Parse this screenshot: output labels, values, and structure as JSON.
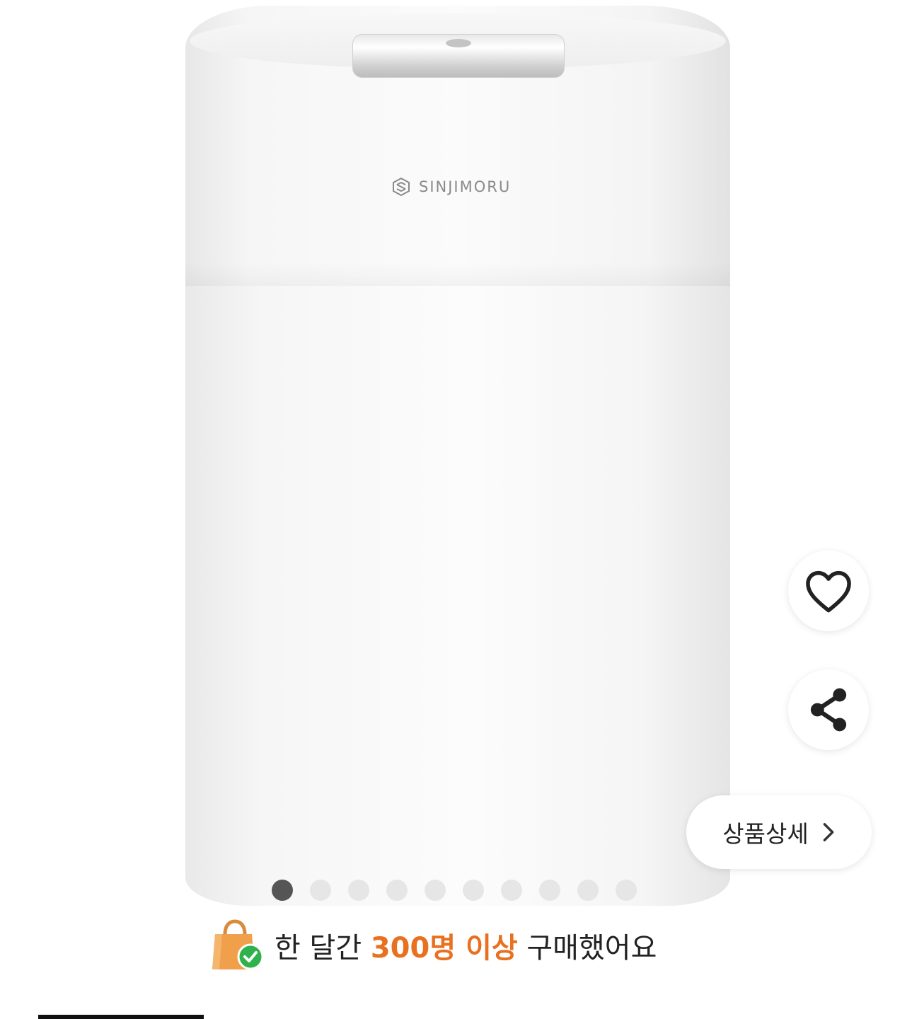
{
  "product": {
    "brand": "SINJIMORU"
  },
  "actions": {
    "favorite_icon": "heart-icon",
    "share_icon": "share-icon",
    "detail_label": "상품상세",
    "detail_icon": "chevron-right-icon"
  },
  "carousel": {
    "total": 10,
    "current": 1
  },
  "purchase_banner": {
    "prefix": "한 달간 ",
    "highlight": "300명 이상",
    "suffix": " 구매했어요",
    "highlight_color": "#e8701f"
  }
}
